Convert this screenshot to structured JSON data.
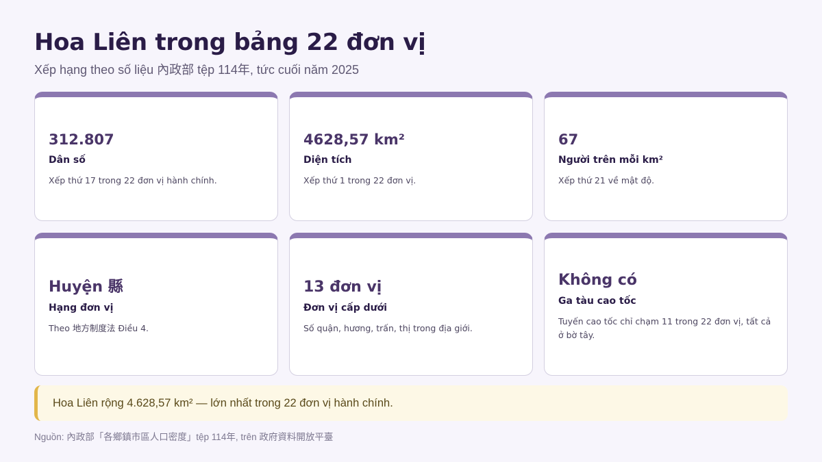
{
  "header": {
    "title": "Hoa Liên trong bảng 22 đơn vị",
    "subtitle": "Xếp hạng theo số liệu 內政部 tệp 114年, tức cuối năm 2025"
  },
  "cards": [
    {
      "value": "312.807",
      "label": "Dân số",
      "desc": "Xếp thứ 17 trong 22 đơn vị hành chính."
    },
    {
      "value": "4628,57 km²",
      "label": "Diện tích",
      "desc": "Xếp thứ 1 trong 22 đơn vị."
    },
    {
      "value": "67",
      "label": "Người trên mỗi km²",
      "desc": "Xếp thứ 21 về mật độ."
    },
    {
      "value": "Huyện 縣",
      "label": "Hạng đơn vị",
      "desc": "Theo 地方制度法 Điều 4."
    },
    {
      "value": "13 đơn vị",
      "label": "Đơn vị cấp dưới",
      "desc": "Số quận, hương, trấn, thị trong địa giới."
    },
    {
      "value": "Không có",
      "label": "Ga tàu cao tốc",
      "desc": "Tuyến cao tốc chỉ chạm 11 trong 22 đơn vị, tất cả ở bờ tây."
    }
  ],
  "callout": {
    "text": "Hoa Liên rộng 4.628,57 km² — lớn nhất trong 22 đơn vị hành chính."
  },
  "source": {
    "text": "Nguồn: 內政部「各鄉鎮市區人口密度」tệp 114年, trên 政府資料開放平臺"
  },
  "colors": {
    "accent": "#8c78b0",
    "callout_border": "#e2b64a",
    "background": "#f7f5fc"
  }
}
